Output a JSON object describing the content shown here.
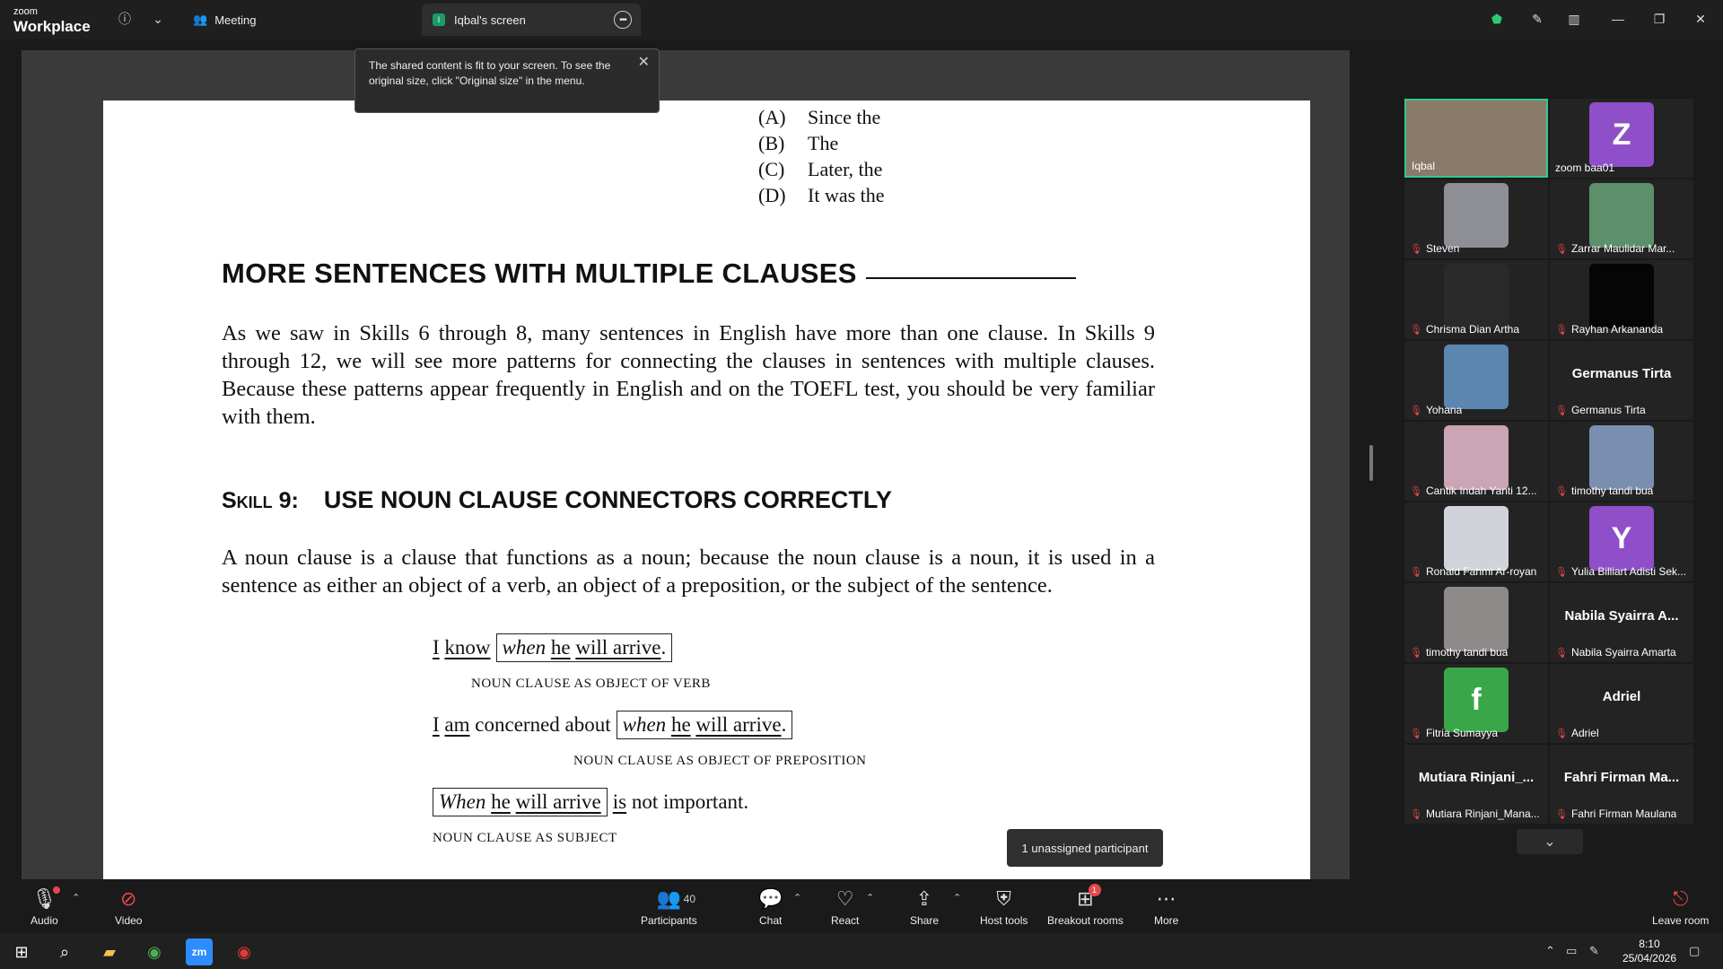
{
  "titlebar": {
    "logo_line1": "zoom",
    "logo_line2": "Workplace",
    "meeting_label": "Meeting",
    "screen_tab_label": "Iqbal's screen",
    "screen_tab_initial": "I"
  },
  "toast": {
    "text": "The shared content is fit to your screen. To see the original size, click \"Original size\" in the menu."
  },
  "document": {
    "options": [
      {
        "key": "(A)",
        "text": "Since the"
      },
      {
        "key": "(B)",
        "text": "The"
      },
      {
        "key": "(C)",
        "text": "Later, the"
      },
      {
        "key": "(D)",
        "text": "It was the"
      }
    ],
    "heading": "MORE SENTENCES WITH MULTIPLE CLAUSES",
    "para1": "As we saw in Skills 6 through 8, many sentences in English have more than one clause. In Skills 9 through 12, we will see more patterns for connecting the clauses in sentences with multiple clauses. Because these patterns appear frequently in English and on the TOEFL test, you should be very familiar with them.",
    "skill_label": "Skill 9:",
    "skill_title": "USE NOUN CLAUSE CONNECTORS CORRECTLY",
    "para2": "A noun clause is a clause that functions as a noun; because the noun clause is a noun, it is used in a sentence as either an object of a verb, an object of a preposition, or the subject of the sentence.",
    "ex1": {
      "i": "I",
      "know": "know",
      "when": "when",
      "he": "he",
      "will_arrive": "will arrive",
      "end": ".",
      "caption": "NOUN CLAUSE AS OBJECT OF VERB"
    },
    "ex2": {
      "i": "I",
      "am": "am",
      "mid": "concerned about",
      "when": "when",
      "he": "he",
      "will_arrive": "will arrive",
      "end": ".",
      "caption": "NOUN CLAUSE AS OBJECT OF PREPOSITION"
    },
    "ex3": {
      "when": "When",
      "he": "he",
      "will_arrive": "will arrive",
      "is": "is",
      "rest": "not important.",
      "caption": "NOUN CLAUSE AS SUBJECT"
    }
  },
  "gallery": {
    "participants": [
      {
        "name": "Iqbal",
        "active": true,
        "kind": "video",
        "color": "#8a7a6a"
      },
      {
        "name": "zoom baa01",
        "kind": "letter",
        "letter": "Z",
        "color": "#8e4fc9"
      },
      {
        "name": "Steven",
        "muted": true,
        "kind": "video",
        "color": "#8d8f94"
      },
      {
        "name": "Zarrar Maulidar Mar...",
        "muted": true,
        "kind": "video",
        "color": "#5c8f6a"
      },
      {
        "name": "Chrisma Dian Artha",
        "muted": true,
        "kind": "blank",
        "color": "#2a2a2a"
      },
      {
        "name": "Rayhan Arkananda",
        "muted": true,
        "kind": "video",
        "color": "#050505"
      },
      {
        "name": "Yohana",
        "muted": true,
        "kind": "video",
        "color": "#5a86b0"
      },
      {
        "name": "Germanus Tirta",
        "muted": true,
        "kind": "name",
        "big": "Germanus Tirta"
      },
      {
        "name": "Cantik Indah Yanti 12...",
        "muted": true,
        "kind": "video",
        "color": "#c9a5b5"
      },
      {
        "name": "timothy tandi bua",
        "muted": true,
        "kind": "video",
        "color": "#7a8fb0"
      },
      {
        "name": "Ronald Fahmi Ar-royan",
        "muted": true,
        "kind": "avatar",
        "color": "#d0d4da"
      },
      {
        "name": "Yulia Billiart Adisti Sek...",
        "muted": true,
        "kind": "letter",
        "letter": "Y",
        "color": "#8e4fc9"
      },
      {
        "name": "timothy tandi bua",
        "muted": true,
        "kind": "video",
        "color": "#8f8a8a"
      },
      {
        "name": "Nabila Syairra Amarta",
        "muted": true,
        "kind": "name",
        "big": "Nabila Syairra A..."
      },
      {
        "name": "Fitria Sumayya",
        "muted": true,
        "kind": "letter",
        "letter": "f",
        "color": "#3aa64a"
      },
      {
        "name": "Adriel",
        "muted": true,
        "kind": "name",
        "big": "Adriel"
      },
      {
        "name": "Mutiara Rinjani_Mana...",
        "muted": true,
        "kind": "name",
        "big": "Mutiara Rinjani_..."
      },
      {
        "name": "Fahri Firman Maulana",
        "muted": true,
        "kind": "name",
        "big": "Fahri Firman Ma..."
      }
    ]
  },
  "breakout_notice": "1 unassigned participant",
  "toolbar": {
    "audio": "Audio",
    "video": "Video",
    "participants": "Participants",
    "participants_count": "40",
    "chat": "Chat",
    "react": "React",
    "share": "Share",
    "host_tools": "Host tools",
    "breakout_rooms": "Breakout rooms",
    "breakout_badge": "1",
    "more": "More",
    "leave": "Leave room"
  },
  "taskbar": {
    "time": "8:10",
    "date": "25/04/2026"
  }
}
